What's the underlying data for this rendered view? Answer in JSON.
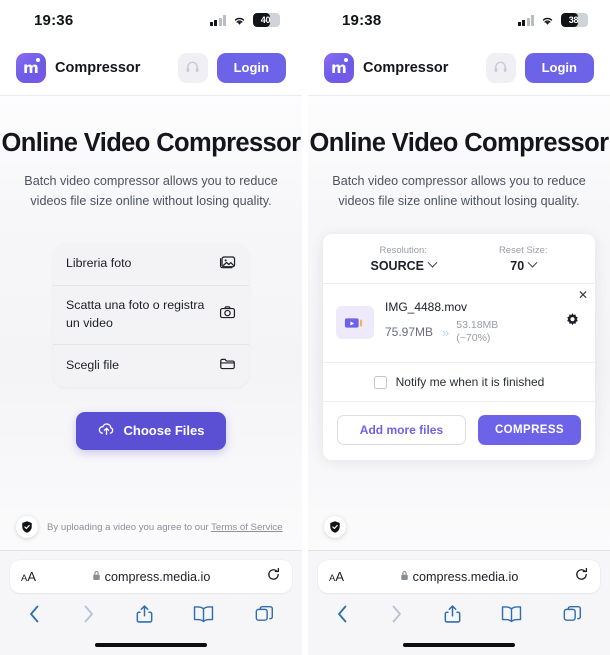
{
  "panels": [
    {
      "status": {
        "time": "19:36",
        "battery": "40",
        "signal_icon": "cellular-signal-icon",
        "wifi_icon": "wifi-icon",
        "battery_icon": "battery-icon"
      },
      "header": {
        "brand": "Compressor",
        "logo_letter": "m",
        "support_icon": "headset-icon",
        "login_label": "Login"
      },
      "hero": {
        "title": "Online Video Compressor",
        "subtitle": "Batch video compressor allows you to reduce videos file size online without losing quality."
      },
      "action_sheet": {
        "items": [
          {
            "label": "Libreria foto",
            "icon": "photo-library-icon"
          },
          {
            "label": "Scatta una foto o registra un video",
            "icon": "camera-icon"
          },
          {
            "label": "Scegli file",
            "icon": "folder-icon"
          }
        ]
      },
      "choose_button": {
        "label": "Choose Files",
        "icon": "upload-cloud-icon"
      },
      "terms": {
        "icon": "shield-check-icon",
        "text": "By uploading a video you agree to our ",
        "link": "Terms of Service"
      },
      "safari": {
        "aa_label": "AA",
        "lock_icon": "lock-icon",
        "url": "compress.media.io",
        "reload_icon": "reload-icon",
        "toolbar": [
          "back-icon",
          "forward-icon",
          "share-icon",
          "bookmarks-icon",
          "tabs-icon"
        ]
      }
    },
    {
      "status": {
        "time": "19:38",
        "battery": "38",
        "signal_icon": "cellular-signal-icon",
        "wifi_icon": "wifi-icon",
        "battery_icon": "battery-icon"
      },
      "header": {
        "brand": "Compressor",
        "logo_letter": "m",
        "support_icon": "headset-icon",
        "login_label": "Login"
      },
      "hero": {
        "title": "Online Video Compressor",
        "subtitle": "Batch video compressor allows you to reduce videos file size online without losing quality."
      },
      "card": {
        "resolution": {
          "label": "Resolution:",
          "value": "SOURCE"
        },
        "reset_size": {
          "label": "Reset Size:",
          "value": "70"
        },
        "file": {
          "thumb_icon": "video-file-icon",
          "name": "IMG_4488.mov",
          "size_before": "75.97MB",
          "arrow_icon": "double-chevron-right-icon",
          "size_after": "53.18MB",
          "size_after_pct": "(~70%)",
          "settings_icon": "gear-icon",
          "close_icon": "close-icon"
        },
        "notify": {
          "label": "Notify me when it is finished",
          "checked": false
        },
        "add_more_label": "Add more files",
        "compress_label": "COMPRESS"
      },
      "terms": {
        "icon": "shield-check-icon",
        "text": "",
        "link": ""
      },
      "safari": {
        "aa_label": "AA",
        "lock_icon": "lock-icon",
        "url": "compress.media.io",
        "reload_icon": "reload-icon",
        "toolbar": [
          "back-icon",
          "forward-icon",
          "share-icon",
          "bookmarks-icon",
          "tabs-icon"
        ]
      }
    }
  ],
  "colors": {
    "accent": "#6c63e8",
    "accent_dark": "#5b4fd4",
    "text": "#15161c",
    "muted": "#8d8f9c",
    "safari_blue": "#2f6fae"
  }
}
